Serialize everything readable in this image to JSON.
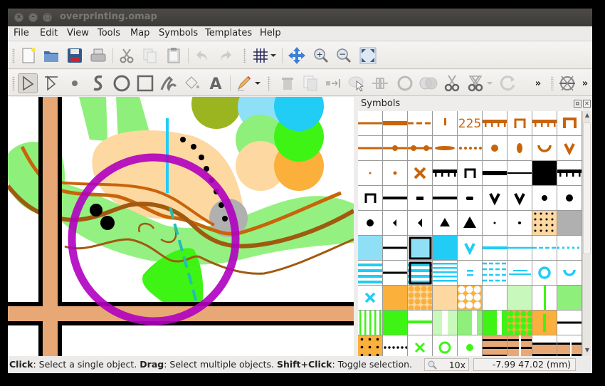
{
  "window": {
    "title": "overprinting.omap",
    "controls": [
      "close",
      "minimize",
      "maximize"
    ]
  },
  "menubar": {
    "items": [
      {
        "label": "File",
        "mnemonic": "F"
      },
      {
        "label": "Edit",
        "mnemonic": "E"
      },
      {
        "label": "View",
        "mnemonic": "V"
      },
      {
        "label": "Tools",
        "mnemonic": "T"
      },
      {
        "label": "Map",
        "mnemonic": "a"
      },
      {
        "label": "Symbols",
        "mnemonic": "m"
      },
      {
        "label": "Templates",
        "mnemonic": "T"
      },
      {
        "label": "Help",
        "mnemonic": "H"
      }
    ]
  },
  "toolbar_main": {
    "buttons": [
      "new-file",
      "open-file",
      "save",
      "print",
      "cut",
      "copy",
      "paste",
      "undo",
      "redo",
      "grid-toggle",
      "grid-menu",
      "pan",
      "zoom-in",
      "zoom-out",
      "show-all"
    ]
  },
  "toolbar_edit": {
    "buttons": [
      "edit-objects",
      "edit-lines",
      "set-point",
      "draw-path",
      "draw-circle",
      "draw-rectangle",
      "draw-freehand",
      "fill-bucket",
      "write-text",
      "pencil",
      "pencil-menu",
      "delete",
      "duplicate",
      "switch-symbol",
      "fill-border",
      "connect-paths",
      "unify-areas",
      "intersect-areas",
      "cut-object",
      "cut-hole",
      "cut-hole-menu",
      "rotate-pattern",
      "more-overflow",
      "measure",
      "more-overflow-2"
    ],
    "overflow_label": "»"
  },
  "symbols_panel": {
    "title": "Symbols",
    "float_label": "⧉",
    "close_label": "✕",
    "scroll_up": "▲",
    "scroll_down": "▼"
  },
  "symbols_grid": {
    "label_225": "225",
    "rows": 10,
    "columns": 9
  },
  "map_colors": {
    "brown": "#c8640a",
    "dark_brown": "#a05a10",
    "light_green": "#8ef07a",
    "bright_green": "#3ef414",
    "cyan": "#21ccf5",
    "light_cyan": "#8fe0f7",
    "olive": "#9bb520",
    "peach": "#fdd8a0",
    "orange": "#fbb03b",
    "road": "#e7a876",
    "purple": "#b000c0",
    "grey": "#b0b0b0"
  },
  "status": {
    "parts": [
      {
        "text": "Click",
        "bold": true
      },
      {
        "text": ": Select a single object. ",
        "bold": false
      },
      {
        "text": "Drag",
        "bold": true
      },
      {
        "text": ": Select multiple objects. ",
        "bold": false
      },
      {
        "text": "Shift+Click",
        "bold": true
      },
      {
        "text": ": Toggle selection.",
        "bold": false
      }
    ],
    "zoom": "10x",
    "coordinates": "-7.99 47.02 (mm)"
  }
}
